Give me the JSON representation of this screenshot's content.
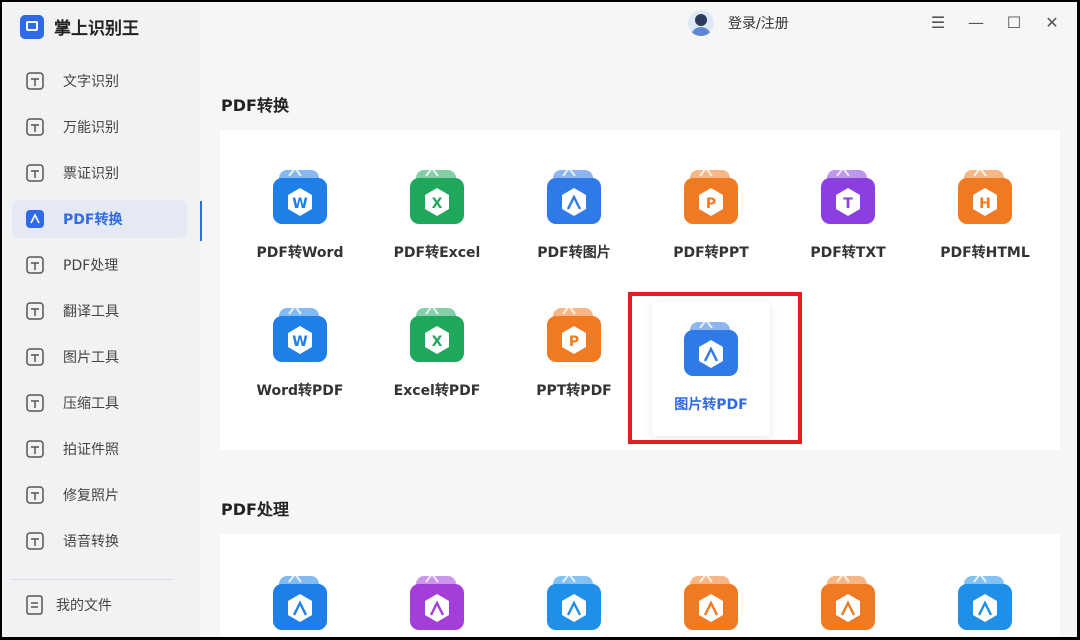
{
  "app": {
    "title": "掌上识别王"
  },
  "user": {
    "login_label": "登录/注册"
  },
  "window_controls": [
    "menu",
    "minimize",
    "maximize",
    "close"
  ],
  "sidebar": {
    "items": [
      {
        "label": "文字识别",
        "icon": "text-recognition-icon"
      },
      {
        "label": "万能识别",
        "icon": "universal-recognition-icon"
      },
      {
        "label": "票证识别",
        "icon": "ticket-recognition-icon"
      },
      {
        "label": "PDF转换",
        "icon": "pdf-convert-icon",
        "active": true
      },
      {
        "label": "PDF处理",
        "icon": "pdf-process-icon"
      },
      {
        "label": "翻译工具",
        "icon": "translate-icon"
      },
      {
        "label": "图片工具",
        "icon": "image-tools-icon"
      },
      {
        "label": "压缩工具",
        "icon": "compress-icon"
      },
      {
        "label": "拍证件照",
        "icon": "id-photo-icon"
      },
      {
        "label": "修复照片",
        "icon": "repair-photo-icon"
      },
      {
        "label": "语音转换",
        "icon": "voice-convert-icon"
      }
    ],
    "my_files": "我的文件"
  },
  "sections": {
    "pdf_convert": {
      "title": "PDF转换",
      "tools": [
        {
          "label": "PDF转Word",
          "letter": "W",
          "color": "#1f7fe8"
        },
        {
          "label": "PDF转Excel",
          "letter": "X",
          "color": "#1fa85c"
        },
        {
          "label": "PDF转图片",
          "letter": "",
          "color": "#2f7ae6"
        },
        {
          "label": "PDF转PPT",
          "letter": "P",
          "color": "#f07a22"
        },
        {
          "label": "PDF转TXT",
          "letter": "T",
          "color": "#8b3fe0"
        },
        {
          "label": "PDF转HTML",
          "letter": "H",
          "color": "#f07a22"
        },
        {
          "label": "Word转PDF",
          "letter": "W",
          "color": "#1f7fe8"
        },
        {
          "label": "Excel转PDF",
          "letter": "X",
          "color": "#1fa85c"
        },
        {
          "label": "PPT转PDF",
          "letter": "P",
          "color": "#f07a22"
        },
        {
          "label": "图片转PDF",
          "letter": "",
          "color": "#2f7ae6",
          "selected": true
        }
      ]
    },
    "pdf_process": {
      "title": "PDF处理",
      "tools": [
        {
          "icon": "pdf-edit-icon",
          "color": "#1f7fe8"
        },
        {
          "icon": "pdf-move-icon",
          "color": "#a33fd8"
        },
        {
          "icon": "pdf-compress-icon",
          "color": "#1f8fe8"
        },
        {
          "icon": "pdf-unlock-icon",
          "color": "#f07a22"
        },
        {
          "icon": "pdf-encrypt-icon",
          "color": "#f07a22"
        },
        {
          "icon": "pdf-merge-icon",
          "color": "#1f8fe8"
        }
      ]
    }
  }
}
